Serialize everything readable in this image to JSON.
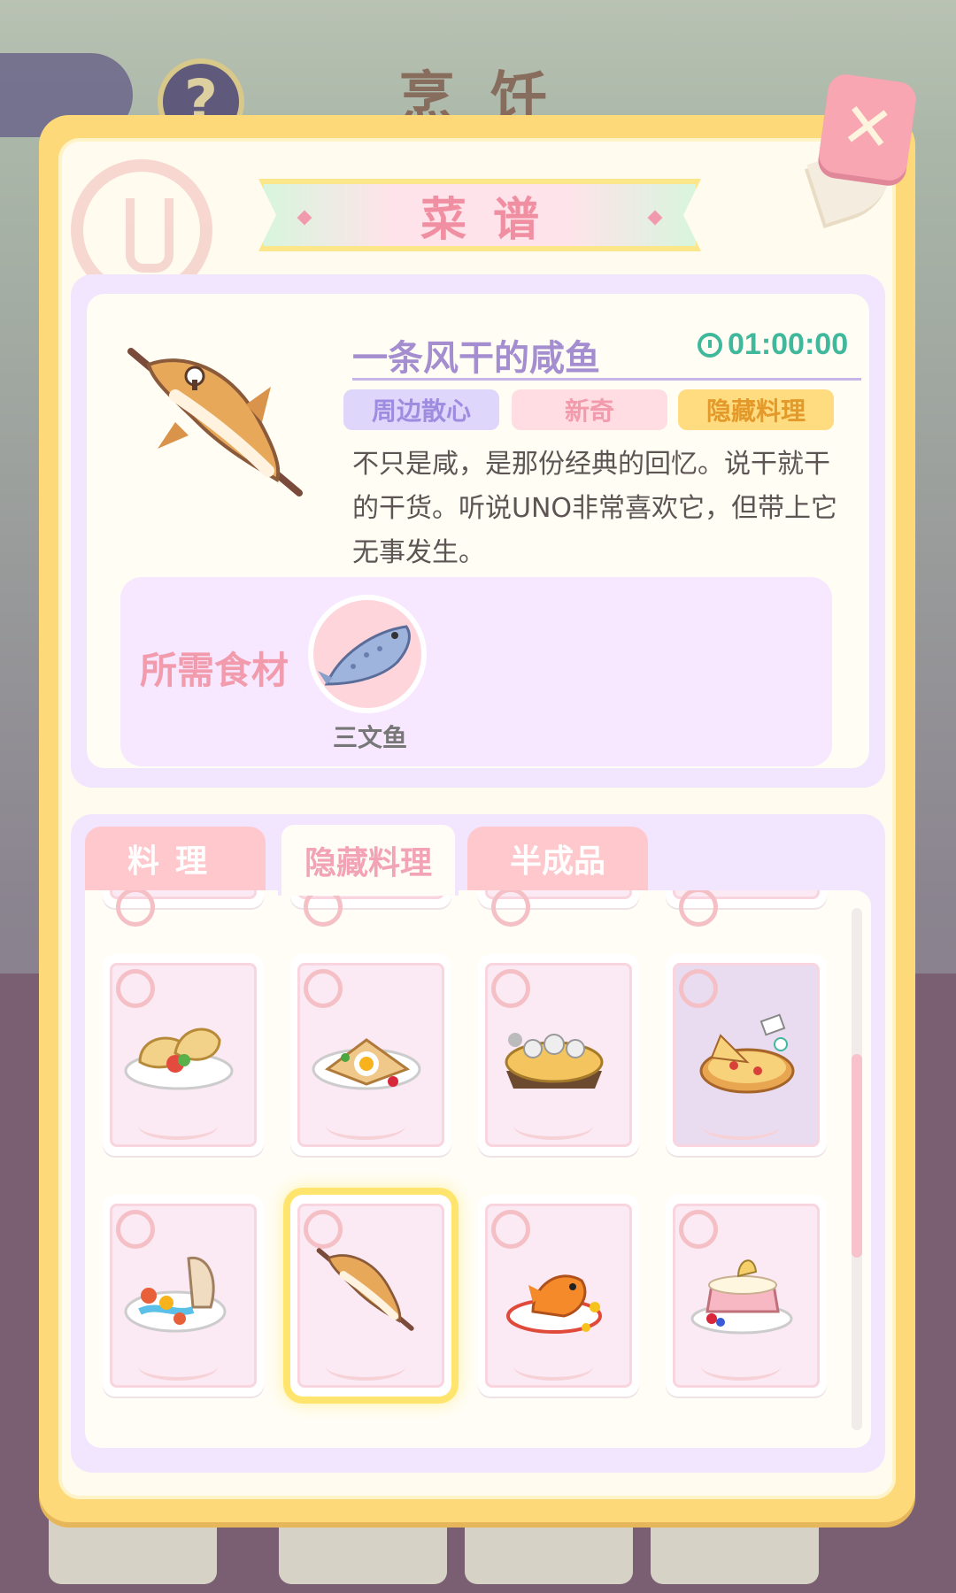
{
  "background": {
    "screen_title": "烹饪",
    "help_label": "?"
  },
  "close_label": "✕",
  "panel": {
    "title": "菜谱"
  },
  "detail": {
    "name": "一条风干的咸鱼",
    "timer": "01:00:00",
    "tags": [
      "周边散心",
      "新奇",
      "隐藏料理"
    ],
    "description": "不只是咸，是那份经典的回忆。说干就干的干货。听说UNO非常喜欢它，但带上它无事发生。",
    "ingredients_label": "所需食材",
    "ingredients": [
      {
        "name": "三文鱼",
        "icon": "salmon-icon"
      }
    ]
  },
  "tabs": [
    "料理",
    "隐藏料理",
    "半成品"
  ],
  "active_tab": "隐藏料理",
  "recipes": [
    {
      "icon": "taiyaki-wrap-dish-icon",
      "state": "normal"
    },
    {
      "icon": "galette-egg-dish-icon",
      "state": "normal"
    },
    {
      "icon": "cheese-tart-dish-icon",
      "state": "normal"
    },
    {
      "icon": "pizza-dish-icon",
      "state": "dim"
    },
    {
      "icon": "seafood-platter-dish-icon",
      "state": "normal"
    },
    {
      "icon": "dried-salted-fish-dish-icon",
      "state": "selected"
    },
    {
      "icon": "goldfish-dish-icon",
      "state": "normal"
    },
    {
      "icon": "pig-cake-dish-icon",
      "state": "normal"
    }
  ],
  "colors": {
    "panel_frame": "#fdd97a",
    "accent_pink": "#f19bac",
    "accent_purple": "#a48ed0",
    "timer_green": "#3fb89b",
    "selected_glow": "#ffe46e"
  }
}
